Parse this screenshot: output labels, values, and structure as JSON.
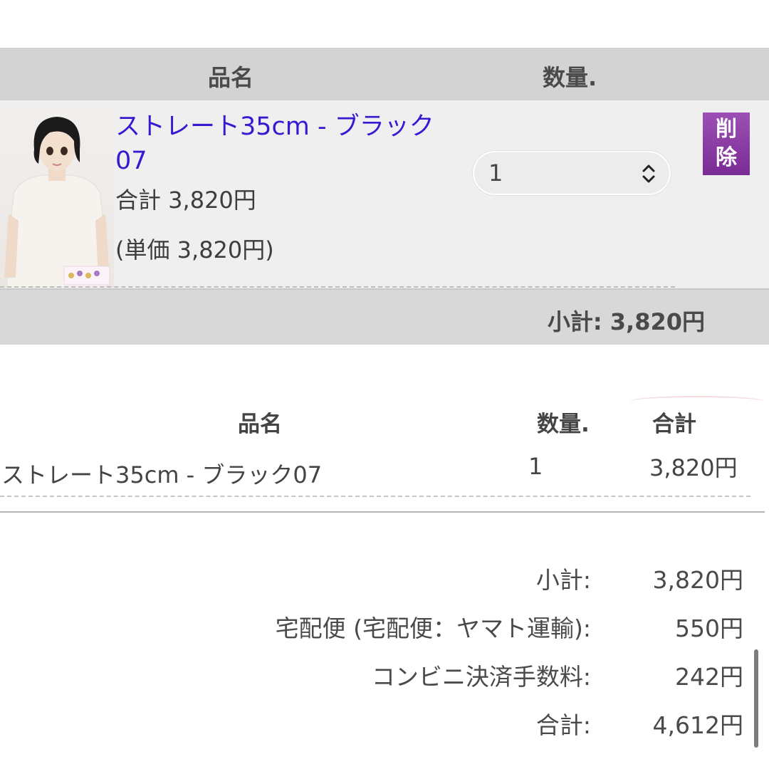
{
  "cart": {
    "header": {
      "name": "品名",
      "qty": "数量."
    },
    "item": {
      "name": "ストレート35cm - ブラック07",
      "name_line1": "ストレート35cm - ブラック",
      "name_line2": "07",
      "total": "合計 3,820円",
      "unit_price": "(単価 3,820円)",
      "quantity": "1",
      "delete_label_1": "削",
      "delete_label_2": "除"
    },
    "subtotal": "小計: 3,820円"
  },
  "summary": {
    "header": {
      "name": "品名",
      "qty": "数量.",
      "total": "合計"
    },
    "rows": [
      {
        "name": "ストレート35cm - ブラック07",
        "qty": "1",
        "total": "3,820円"
      }
    ],
    "totals": [
      {
        "label": "小計:",
        "value": "3,820円"
      },
      {
        "label": "宅配便 (宅配便：ヤマト運輸):",
        "value": "550円"
      },
      {
        "label": "コンビニ決済手数料:",
        "value": "242円"
      },
      {
        "label": "合計:",
        "value": "4,612円"
      }
    ]
  },
  "colors": {
    "link": "#3a18d0",
    "delete_button": "#8a3aa6",
    "header_bg": "#d3d3d3",
    "row_bg": "#efefef"
  },
  "icons": {
    "select": "chevron-up-down-icon"
  }
}
